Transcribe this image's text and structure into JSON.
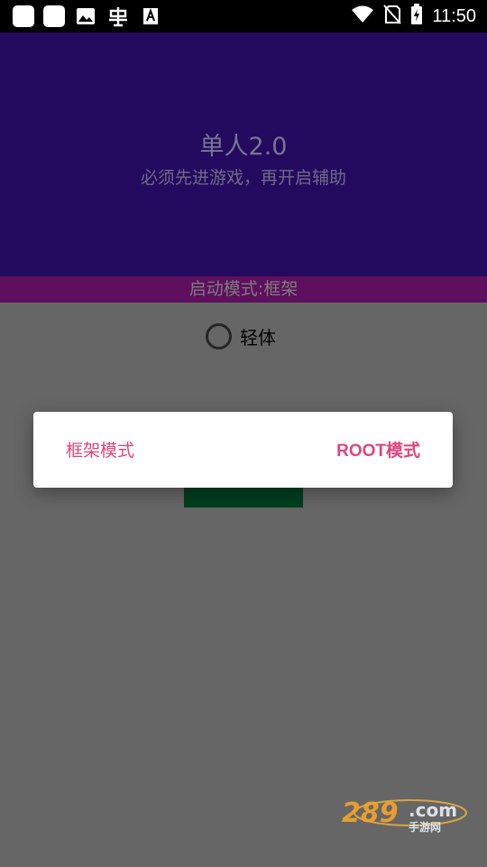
{
  "status_bar": {
    "time": "11:50",
    "icons": [
      "app-square-icon",
      "app-square-icon",
      "image-icon",
      "bug-icon",
      "font-icon",
      "wifi-icon",
      "no-sim-icon",
      "battery-charging-icon"
    ]
  },
  "header": {
    "title": "单人2.0",
    "subtitle": "必须先进游戏，再开启辅助"
  },
  "mode_bar": {
    "text": "启动模式:框架"
  },
  "radio": {
    "label": "轻体",
    "checked": false
  },
  "dialog": {
    "option_left": "框架模式",
    "option_right": "ROOT模式",
    "accent_color": "#e0457f"
  },
  "watermark": {
    "logo_text": "289.com",
    "logo_subtext": "手游网"
  },
  "colors": {
    "header_bg": "#230a5f",
    "mode_bar_bg": "#5e0f5e",
    "page_bg": "#666666",
    "start_button_bg": "#003f1f"
  }
}
